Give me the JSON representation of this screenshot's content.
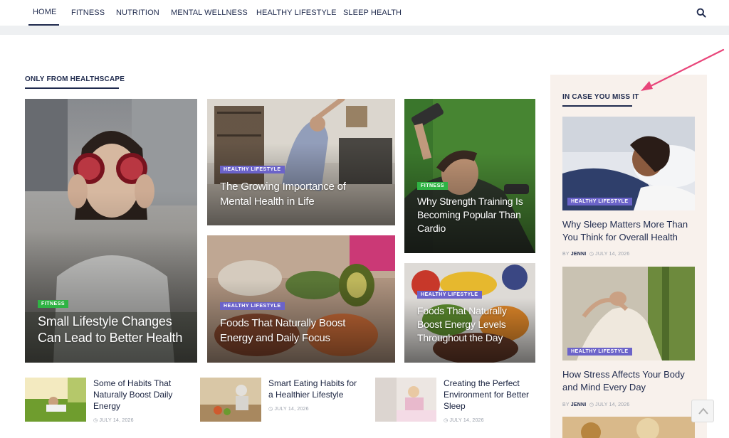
{
  "nav": {
    "items": [
      {
        "label": "HOME",
        "active": true
      },
      {
        "label": "FITNESS"
      },
      {
        "label": "NUTRITION"
      },
      {
        "label": "MENTAL WELLNESS"
      },
      {
        "label": "HEALTHY LIFESTYLE"
      },
      {
        "label": "SLEEP HEALTH"
      }
    ],
    "search_icon": "search-icon"
  },
  "main": {
    "section_label": "ONLY FROM HEALTHSCAPE",
    "feature": {
      "badge": "FITNESS",
      "title": "Small Lifestyle Changes Can Lead to Better Health"
    },
    "cards": [
      {
        "badge": "HEALTHY LIFESTYLE",
        "title": "The Growing Importance of Mental Health in Life"
      },
      {
        "badge": "FITNESS",
        "title": "Why Strength Training Is Becoming Popular Than Cardio"
      },
      {
        "badge": "HEALTHY LIFESTYLE",
        "title": "Foods That Naturally Boost Energy and Daily Focus"
      },
      {
        "badge": "HEALTHY LIFESTYLE",
        "title": "Foods That Naturally Boost Energy Levels Throughout the Day"
      }
    ],
    "list": [
      {
        "title": "Some of Habits That Naturally Boost Daily Energy",
        "date": "JULY 14, 2026"
      },
      {
        "title": "Smart Eating Habits for a Healthier Lifestyle",
        "date": "JULY 14, 2026"
      },
      {
        "title": "Creating the Perfect Environment for Better Sleep",
        "date": "JULY 14, 2026"
      }
    ]
  },
  "sidebar": {
    "section_label": "IN CASE YOU MISS IT",
    "posts": [
      {
        "badge": "HEALTHY LIFESTYLE",
        "title": "Why Sleep Matters More Than You Think for Overall Health",
        "by": "BY",
        "author": "JENNI",
        "date": "JULY 14, 2026"
      },
      {
        "badge": "HEALTHY LIFESTYLE",
        "title": "How Stress Affects Your Body and Mind Every Day",
        "by": "BY",
        "author": "JENNI",
        "date": "JULY 14, 2026"
      }
    ]
  },
  "colors": {
    "navy": "#1f2a4d",
    "badge_lifestyle": "#6b63c9",
    "badge_fitness": "#2fb344",
    "sidebar_bg": "#f8f1ec",
    "annotation_arrow": "#e8457a"
  },
  "icons": {
    "clock": "clock-icon",
    "back_to_top": "chevron-up-icon"
  }
}
